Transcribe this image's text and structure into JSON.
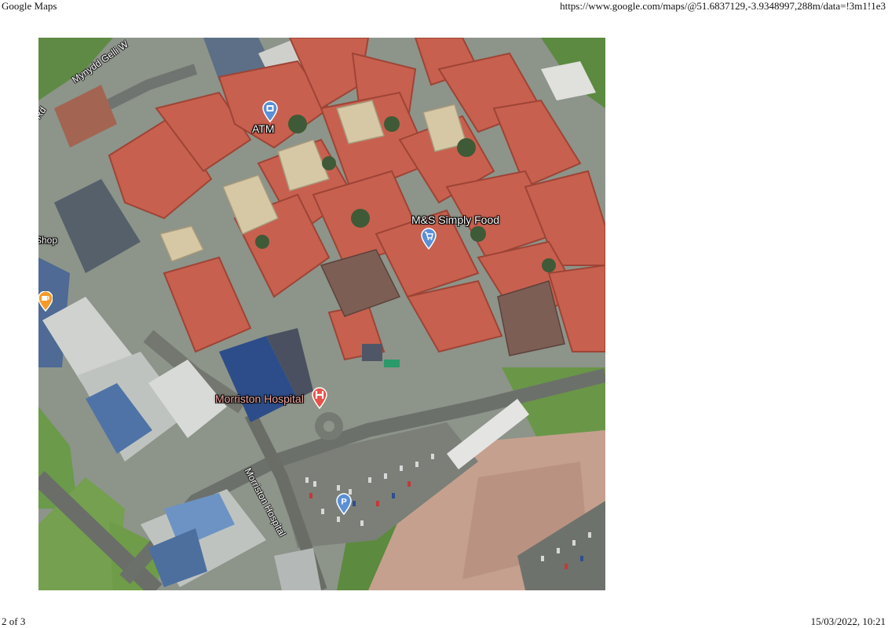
{
  "header": {
    "title": "Google Maps",
    "url": "https://www.google.com/maps/@51.6837129,-3.9348997,288m/data=!3m1!1e3"
  },
  "footer": {
    "page": "2 of 3",
    "datetime": "15/03/2022, 10:21"
  },
  "map": {
    "view": "satellite",
    "labels": {
      "atm": "ATM",
      "ms": "M&S Simply Food",
      "hospital": "Morriston Hospital",
      "shop": "Shop",
      "road_hospital": "Morriston Hospital",
      "road_mynydd": "Mynydd Gelli W",
      "road_rd": "Rd"
    },
    "icons": {
      "atm": "atm-pin-icon",
      "ms": "shopping-cart-pin-icon",
      "hospital": "hospital-pin-icon",
      "parking": "parking-pin-icon",
      "cafe": "cafe-pin-icon"
    },
    "colors": {
      "poi_blue": "#5b8fd6",
      "hospital_red": "#e8524a",
      "cafe_orange": "#f59a2a",
      "roof_terracotta": "#c8604f",
      "asphalt": "#7e827a"
    }
  }
}
